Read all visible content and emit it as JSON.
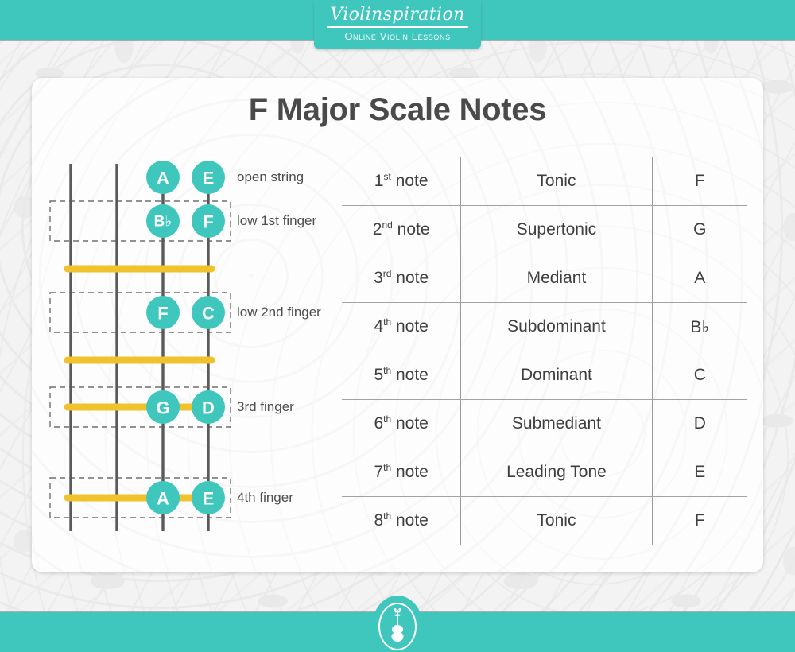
{
  "brand": {
    "wordmark": "Violinspiration",
    "tagline": "Online Violin Lessons",
    "badge_icon": "violin-icon",
    "teal": "#3fc7bd",
    "yellow": "#f0c32c",
    "string_gray": "#5a5a5a",
    "text_gray": "#4a4a4a"
  },
  "header": {
    "title": "F Major Scale Notes"
  },
  "fingerboard": {
    "strings": [
      "G",
      "D",
      "A",
      "E"
    ],
    "rows": [
      {
        "label": "open string",
        "dashed_box": false,
        "tape": false,
        "notes": [
          {
            "string_index": 2,
            "label": "A"
          },
          {
            "string_index": 3,
            "label": "E"
          }
        ]
      },
      {
        "label": "low 1st finger",
        "dashed_box": true,
        "tape": false,
        "notes": [
          {
            "string_index": 2,
            "label": "B♭"
          },
          {
            "string_index": 3,
            "label": "F"
          }
        ]
      },
      {
        "label": "low 2nd finger",
        "dashed_box": true,
        "tape": false,
        "notes": [
          {
            "string_index": 2,
            "label": "F"
          },
          {
            "string_index": 3,
            "label": "C"
          }
        ]
      },
      {
        "label": "3rd finger",
        "dashed_box": true,
        "tape": true,
        "notes": [
          {
            "string_index": 2,
            "label": "G"
          },
          {
            "string_index": 3,
            "label": "D"
          }
        ]
      },
      {
        "label": "4th finger",
        "dashed_box": true,
        "tape": true,
        "notes": [
          {
            "string_index": 2,
            "label": "A"
          },
          {
            "string_index": 3,
            "label": "E"
          }
        ]
      }
    ],
    "standalone_tapes": 2
  },
  "table": {
    "columns": [
      "ordinal",
      "degree",
      "note"
    ],
    "rows": [
      {
        "ordinal_num": "1",
        "ordinal_suffix": "st",
        "ordinal_word": "note",
        "degree": "Tonic",
        "note": "F"
      },
      {
        "ordinal_num": "2",
        "ordinal_suffix": "nd",
        "ordinal_word": "note",
        "degree": "Supertonic",
        "note": "G"
      },
      {
        "ordinal_num": "3",
        "ordinal_suffix": "rd",
        "ordinal_word": "note",
        "degree": "Mediant",
        "note": "A"
      },
      {
        "ordinal_num": "4",
        "ordinal_suffix": "th",
        "ordinal_word": "note",
        "degree": "Subdominant",
        "note": "B♭"
      },
      {
        "ordinal_num": "5",
        "ordinal_suffix": "th",
        "ordinal_word": "note",
        "degree": "Dominant",
        "note": "C"
      },
      {
        "ordinal_num": "6",
        "ordinal_suffix": "th",
        "ordinal_word": "note",
        "degree": "Submediant",
        "note": "D"
      },
      {
        "ordinal_num": "7",
        "ordinal_suffix": "th",
        "ordinal_word": "note",
        "degree": "Leading Tone",
        "note": "E"
      },
      {
        "ordinal_num": "8",
        "ordinal_suffix": "th",
        "ordinal_word": "note",
        "degree": "Tonic",
        "note": "F"
      }
    ]
  }
}
